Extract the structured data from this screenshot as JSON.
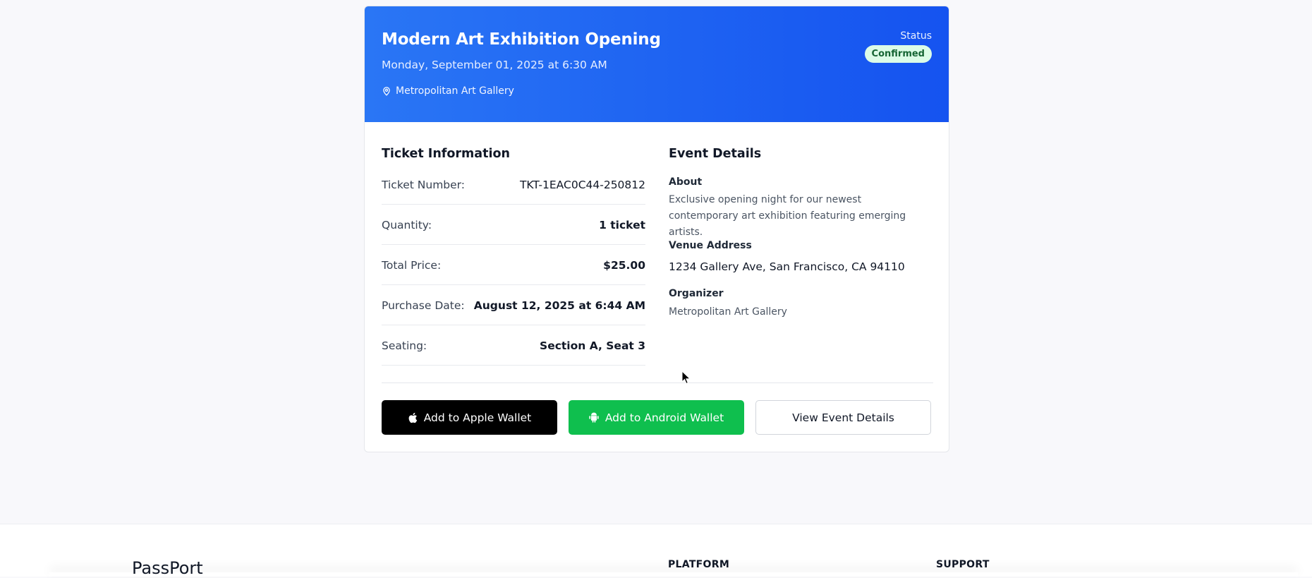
{
  "event": {
    "title": "Modern Art Exhibition Opening",
    "date": "Monday, September 01, 2025 at 6:30 AM",
    "location": "Metropolitan Art Gallery",
    "status_label": "Status",
    "status": "Confirmed"
  },
  "ticket": {
    "heading": "Ticket Information",
    "rows": [
      {
        "label": "Ticket Number:",
        "value": "TKT-1EAC0C44-250812"
      },
      {
        "label": "Quantity:",
        "value": "1 ticket"
      },
      {
        "label": "Total Price:",
        "value": "$25.00"
      },
      {
        "label": "Purchase Date:",
        "value": "August 12, 2025 at 6:44 AM"
      },
      {
        "label": "Seating:",
        "value": "Section A, Seat 3"
      }
    ]
  },
  "details": {
    "heading": "Event Details",
    "about_label": "About",
    "about_text": "Exclusive opening night for our newest contemporary art exhibition featuring emerging artists.",
    "venue_label": "Venue Address",
    "venue_address": "1234 Gallery Ave, San Francisco, CA 94110",
    "organizer_label": "Organizer",
    "organizer": "Metropolitan Art Gallery"
  },
  "actions": {
    "apple_wallet": "Add to Apple Wallet",
    "android_wallet": "Add to Android Wallet",
    "view_details": "View Event Details"
  },
  "footer": {
    "brand": "PassPort",
    "platform_heading": "PLATFORM",
    "support_heading": "SUPPORT"
  },
  "colors": {
    "hero_gradient_start": "#2a76f5",
    "hero_gradient_end": "#1553f0",
    "status_badge_bg": "#dcfce7",
    "status_badge_text": "#166534",
    "android_green": "#0fbf4e"
  },
  "icons": {
    "location": "map-pin-icon",
    "apple": "apple-icon",
    "android": "android-icon"
  }
}
